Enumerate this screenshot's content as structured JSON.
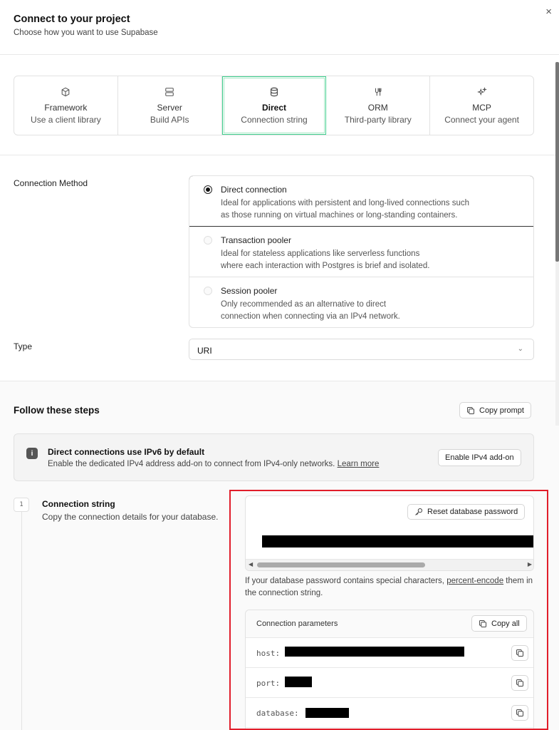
{
  "dialog": {
    "title": "Connect to your project",
    "subtitle": "Choose how you want to use Supabase",
    "close_glyph": "×"
  },
  "tabs": [
    {
      "label": "Framework",
      "desc": "Use a client library",
      "icon": "cube-icon"
    },
    {
      "label": "Server",
      "desc": "Build APIs",
      "icon": "server-icon"
    },
    {
      "label": "Direct",
      "desc": "Connection string",
      "icon": "database-icon",
      "active": true
    },
    {
      "label": "ORM",
      "desc": "Third-party library",
      "icon": "orm-icon"
    },
    {
      "label": "MCP",
      "desc": "Connect your agent",
      "icon": "sparkles-icon"
    }
  ],
  "settings": {
    "connection_method_label": "Connection Method",
    "methods": [
      {
        "title": "Direct connection",
        "desc_line1": "Ideal for applications with persistent and long-lived connections such",
        "desc_line2": "as those running on virtual machines or long-standing containers.",
        "selected": true
      },
      {
        "title": "Transaction pooler",
        "desc_line1": "Ideal for stateless applications like serverless functions",
        "desc_line2": "where each interaction with Postgres is brief and isolated.",
        "selected": false
      },
      {
        "title": "Session pooler",
        "desc_line1": "Only recommended as an alternative to direct",
        "desc_line2": "connection when connecting via an IPv4 network.",
        "selected": false
      }
    ],
    "type_label": "Type",
    "type_value": "URI",
    "chevron_glyph": "⌄"
  },
  "steps": {
    "title": "Follow these steps",
    "copy_prompt": "Copy prompt",
    "info": {
      "title": "Direct connections use IPv6 by default",
      "text": "Enable the dedicated IPv4 address add-on to connect from IPv4-only networks. ",
      "link": "Learn more",
      "button": "Enable IPv4 add-on",
      "icon_glyph": "i"
    },
    "step1": {
      "number": "1",
      "title": "Connection string",
      "desc": "Copy the connection details for your database.",
      "reset_button": "Reset database password",
      "note_text": "If your database password contains special characters, ",
      "note_link": "percent-encode",
      "note_text2": " them in the connection string.",
      "scroll_left": "◀",
      "scroll_right": "▶"
    },
    "params": {
      "title": "Connection parameters",
      "copy_all": "Copy all",
      "rows": [
        {
          "key": "host:"
        },
        {
          "key": "port:"
        },
        {
          "key": "database:"
        }
      ]
    }
  },
  "colors": {
    "accent": "#3ecf8e",
    "highlight": "#e11d2a"
  }
}
